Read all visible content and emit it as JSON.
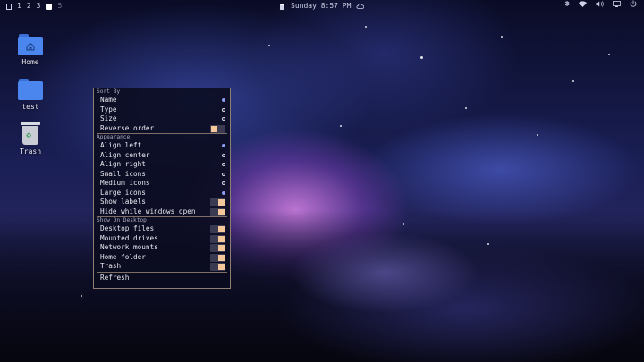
{
  "topbar": {
    "workspaces": [
      "1",
      "2",
      "3",
      "5"
    ],
    "clock": "Sunday 8:57 PM",
    "tray_icons": [
      "bluetooth-icon",
      "wifi-icon",
      "volume-icon",
      "display-icon",
      "power-icon"
    ]
  },
  "desktop_icons": [
    {
      "label": "Home",
      "icon": "home-folder-icon"
    },
    {
      "label": "test",
      "icon": "folder-icon"
    },
    {
      "label": "Trash",
      "icon": "trash-icon"
    }
  ],
  "menu": {
    "sort_by": {
      "title": "Sort By",
      "items": [
        {
          "label": "Name",
          "type": "radio",
          "checked": true
        },
        {
          "label": "Type",
          "type": "radio",
          "checked": false
        },
        {
          "label": "Size",
          "type": "radio",
          "checked": false
        },
        {
          "label": "Reverse order",
          "type": "toggle",
          "checked": false
        }
      ]
    },
    "appearance": {
      "title": "Appearance",
      "items": [
        {
          "label": "Align left",
          "type": "radio",
          "checked": true
        },
        {
          "label": "Align center",
          "type": "radio",
          "checked": false
        },
        {
          "label": "Align right",
          "type": "radio",
          "checked": false
        },
        {
          "label": "Small icons",
          "type": "radio",
          "checked": false
        },
        {
          "label": "Medium icons",
          "type": "radio",
          "checked": false
        },
        {
          "label": "Large icons",
          "type": "radio",
          "checked": true
        },
        {
          "label": "Show labels",
          "type": "toggle",
          "checked": true
        },
        {
          "label": "Hide while windows open",
          "type": "toggle",
          "checked": true
        }
      ]
    },
    "show_on_desktop": {
      "title": "Show On Desktop",
      "items": [
        {
          "label": "Desktop files",
          "type": "toggle",
          "checked": true
        },
        {
          "label": "Mounted drives",
          "type": "toggle",
          "checked": true
        },
        {
          "label": "Network mounts",
          "type": "toggle",
          "checked": true
        },
        {
          "label": "Home folder",
          "type": "toggle",
          "checked": true
        },
        {
          "label": "Trash",
          "type": "toggle",
          "checked": true
        }
      ]
    },
    "refresh_label": "Refresh"
  },
  "colors": {
    "accent": "#8a9af0",
    "toggle_on": "#f3c79a",
    "menu_border": "#8f7f70",
    "folder": "#4a86ee"
  }
}
